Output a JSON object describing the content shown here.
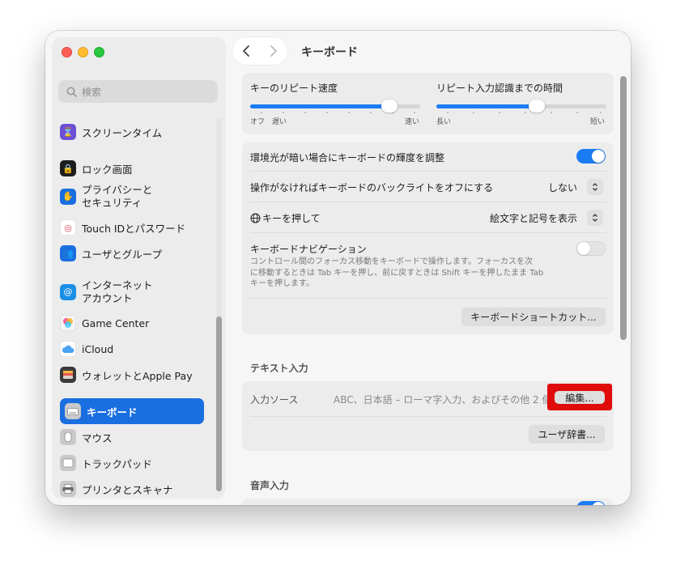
{
  "window": {
    "title": "キーボード"
  },
  "sidebar": {
    "search_placeholder": "検索",
    "items": [
      {
        "label": "スクリーンタイム",
        "icon": "hourglass-icon",
        "color": "#6e4fd8"
      },
      {
        "label": "ロック画面",
        "icon": "lock-icon",
        "color": "#1d1d1f"
      },
      {
        "label": "プライバシーと\nセキュリティ",
        "line1": "プライバシーと",
        "line2": "セキュリティ",
        "icon": "hand-icon",
        "color": "#1a6fe0"
      },
      {
        "label": "Touch IDとパスワード",
        "icon": "fingerprint-icon",
        "color": "#ffffff"
      },
      {
        "label": "ユーザとグループ",
        "icon": "users-icon",
        "color": "#1a6fe0"
      },
      {
        "label": "インターネット\nアカウント",
        "line1": "インターネット",
        "line2": "アカウント",
        "icon": "at-icon",
        "color": "#1a8fe8"
      },
      {
        "label": "Game Center",
        "icon": "game-center-icon",
        "color": "#ff5aa0"
      },
      {
        "label": "iCloud",
        "icon": "cloud-icon",
        "color": "#4aa3f2"
      },
      {
        "label": "ウォレットとApple Pay",
        "icon": "wallet-icon",
        "color": "#3a3a3a"
      },
      {
        "label": "キーボード",
        "icon": "keyboard-icon",
        "color": "#8e8e93"
      },
      {
        "label": "マウス",
        "icon": "mouse-icon",
        "color": "#8e8e93"
      },
      {
        "label": "トラックパッド",
        "icon": "trackpad-icon",
        "color": "#8e8e93"
      },
      {
        "label": "プリンタとスキャナ",
        "icon": "printer-icon",
        "color": "#8e8e93"
      }
    ]
  },
  "keyrepeat": {
    "label": "キーのリピート速度",
    "min_label": "オフ",
    "min2_label": "遅い",
    "max_label": "速い",
    "value": 0.82
  },
  "delay": {
    "label": "リピート入力認識までの時間",
    "min_label": "長い",
    "max_label": "短い",
    "value": 0.59
  },
  "settings": {
    "ambient_label": "環境光が暗い場合にキーボードの輝度を調整",
    "ambient_on": true,
    "backlight_label": "操作がなければキーボードのバックライトをオフにする",
    "backlight_value": "しない",
    "globe_label": "キーを押して",
    "globe_value": "絵文字と記号を表示",
    "nav_label": "キーボードナビゲーション",
    "nav_on": false,
    "nav_desc_1": "コントロール間のフォーカス移動をキーボードで操作します。フォーカスを次",
    "nav_desc_2": "に移動するときは Tab キーを押し、前に戻すときは Shift キーを押したまま Tab",
    "nav_desc_3": "キーを押します。",
    "shortcuts_button": "キーボードショートカット..."
  },
  "text_input": {
    "section_title": "テキスト入力",
    "source_label": "入力ソース",
    "source_value": "ABC、日本語 – ローマ字入力、およびその他 2 個",
    "edit_button": "編集...",
    "dictionary_button": "ユーザ辞書..."
  },
  "voice": {
    "section_title": "音声入力"
  },
  "accent_color": "#1a7cf3",
  "highlight_color": "#e00b0b"
}
